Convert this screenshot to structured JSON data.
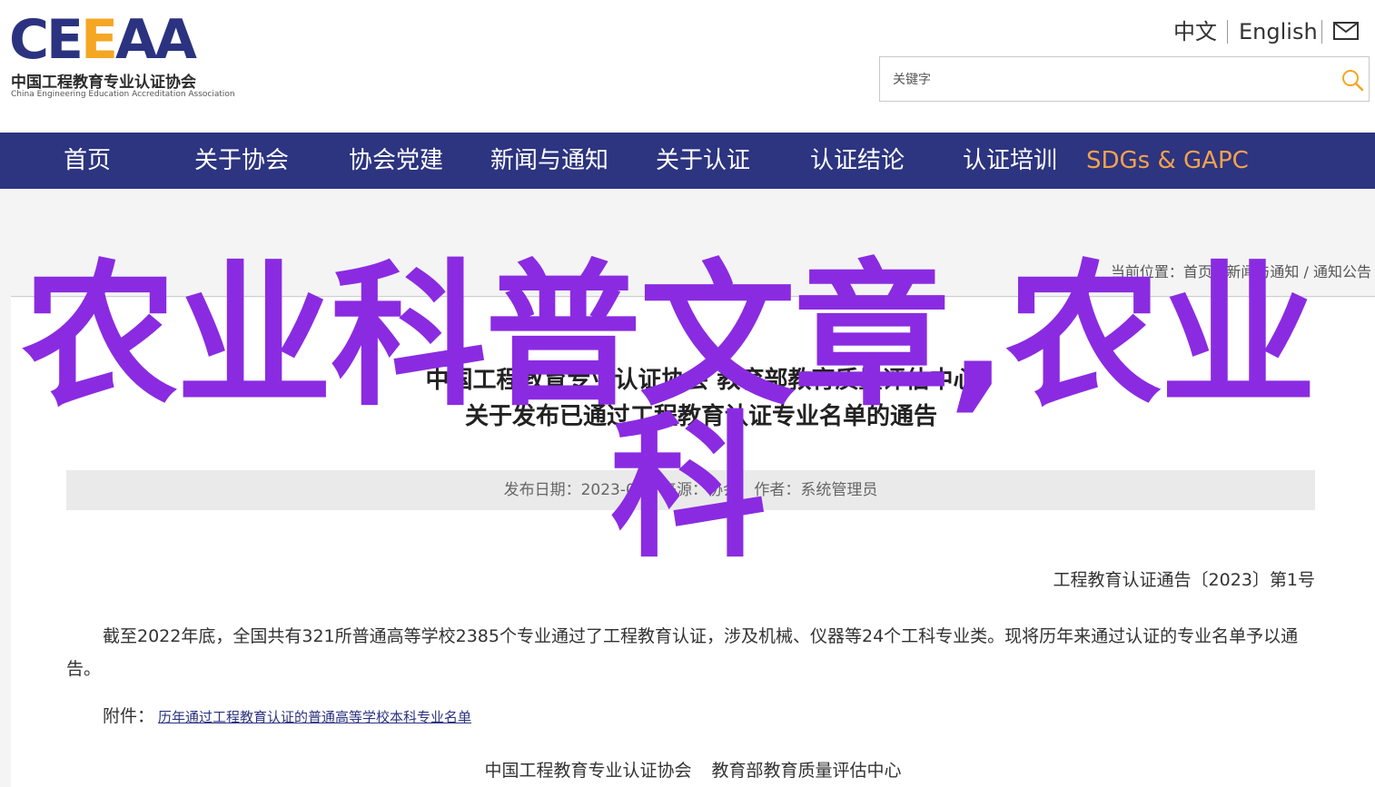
{
  "header": {
    "logo": {
      "mark_prefix": "CE",
      "mark_highlight": "E",
      "mark_suffix": "AA",
      "name_cn": "中国工程教育专业认证协会",
      "name_en": "China Engineering Education Accreditation Association"
    },
    "lang_zh": "中文",
    "lang_en": "English",
    "mail_icon": "mail-icon",
    "search": {
      "placeholder": "关键字",
      "icon": "search-icon"
    }
  },
  "nav": {
    "items": [
      "首页",
      "关于协会",
      "协会党建",
      "新闻与通知",
      "关于认证",
      "认证结论",
      "认证培训",
      "SDGs & GAPC"
    ]
  },
  "breadcrumb": {
    "prefix": "当前位置：",
    "items": [
      "首页",
      "新闻与通知",
      "通知公告"
    ],
    "separator": " / "
  },
  "article": {
    "title_line1": "中国工程教育专业认证协会 教育部教育质量评估中心",
    "title_line2": "关于发布已通过工程教育认证专业名单的通告",
    "meta": {
      "date_label": "发布日期：2023-06",
      "source_label": "来源：协会",
      "author_label": "作者：系统管理员"
    },
    "doc_number": "工程教育认证通告〔2023〕第1号",
    "paragraph": "截至2022年底，全国共有321所普通高等学校2385个专业通过了工程教育认证，涉及机械、仪器等24个工科专业类。现将历年来通过认证的专业名单予以通告。",
    "attachment_label": "附件：",
    "attachment_link": "历年通过工程教育认证的普通高等学校本科专业名单",
    "signatories": [
      "中国工程教育专业认证协会",
      "教育部教育质量评估中心"
    ]
  },
  "overlay": {
    "line1": "农业科普文章,农业",
    "line2": "科"
  },
  "colors": {
    "nav_bg": "#2d3480",
    "nav_accent": "#f2a34c",
    "logo_blue": "#2b3380",
    "logo_orange": "#f5a623",
    "overlay_purple": "#8a2be2",
    "search_icon": "#f5a623"
  }
}
